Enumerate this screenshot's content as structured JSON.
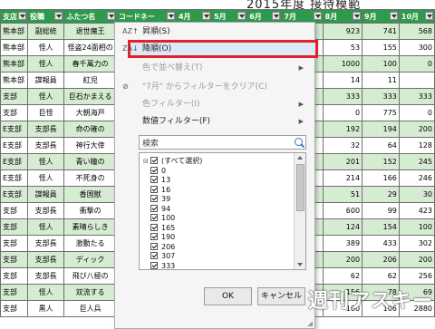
{
  "sheet": {
    "title_partial": "2015年度 接待模範",
    "headers": [
      "支店",
      "役職",
      "ふたつ名",
      "コードネー",
      "4月",
      "5月",
      "6月",
      "7月",
      "8月",
      "9月",
      "10月"
    ],
    "rows": [
      [
        "熊本部",
        "副総統",
        "退世魔王",
        "",
        "",
        "",
        "",
        "",
        "923",
        "741",
        "568"
      ],
      [
        "熊本部",
        "怪人",
        "怪盗24面相の",
        "",
        "",
        "",
        "",
        "",
        "53",
        "155",
        "300"
      ],
      [
        "熊本部",
        "怪人",
        "春千萬力の",
        "",
        "",
        "",
        "",
        "",
        "1000",
        "100",
        "0"
      ],
      [
        "熊本部",
        "諜報員",
        "紅児",
        "",
        "",
        "",
        "",
        "",
        "14",
        "11",
        ""
      ],
      [
        "支部",
        "怪人",
        "巨石かまえる",
        "",
        "",
        "",
        "",
        "",
        "333",
        "333",
        "333"
      ],
      [
        "支部",
        "巨怪",
        "大朝海戸",
        "",
        "",
        "",
        "",
        "",
        "0",
        "775",
        "0"
      ],
      [
        "E支部",
        "支部長",
        "命の確の",
        "",
        "",
        "",
        "",
        "",
        "192",
        "194",
        "200"
      ],
      [
        "E支部",
        "支部長",
        "神行大倖",
        "",
        "",
        "",
        "",
        "",
        "32",
        "64",
        "128"
      ],
      [
        "E支部",
        "怪人",
        "青い瞳の",
        "",
        "",
        "",
        "",
        "",
        "201",
        "152",
        "245"
      ],
      [
        "E支部",
        "怪人",
        "不死身の",
        "",
        "",
        "",
        "",
        "",
        "214",
        "166",
        "246"
      ],
      [
        "E支部",
        "諜報員",
        "香国獣",
        "",
        "",
        "",
        "",
        "",
        "51",
        "29",
        "30"
      ],
      [
        "支部",
        "支部長",
        "衝撃の",
        "",
        "",
        "",
        "",
        "",
        "600",
        "99",
        "423"
      ],
      [
        "支部",
        "怪人",
        "素晴らしき",
        "",
        "",
        "",
        "",
        "",
        "124",
        "154",
        "100"
      ],
      [
        "支部",
        "支部長",
        "激動たる",
        "",
        "",
        "",
        "",
        "",
        "389",
        "433",
        "302"
      ],
      [
        "支部",
        "支部長",
        "ディック",
        "",
        "",
        "",
        "",
        "",
        "200",
        "206",
        "200"
      ],
      [
        "支部",
        "支部長",
        "飛び八極の",
        "",
        "",
        "",
        "",
        "",
        "62",
        "62",
        "256"
      ],
      [
        "支部",
        "怪人",
        "双流する",
        "",
        "",
        "",
        "",
        "",
        "156",
        "78",
        "69"
      ],
      [
        "支部",
        "黒人",
        "巨人兵",
        "",
        "",
        "",
        "",
        "",
        "100",
        "106",
        "2880"
      ]
    ]
  },
  "menu": {
    "items": [
      {
        "icon": "AZ↑",
        "label": "昇順(S)",
        "disabled": false
      },
      {
        "icon": "ZA↓",
        "label": "降順(O)",
        "disabled": false
      },
      {
        "icon": "",
        "label": "色で並べ替え(T)",
        "disabled": true,
        "submenu": true
      },
      {
        "icon": "⊘",
        "label": "\"7月\" からフィルターをクリア(C)",
        "disabled": true
      },
      {
        "icon": "",
        "label": "色フィルター(I)",
        "disabled": true,
        "submenu": true
      },
      {
        "icon": "",
        "label": "数値フィルター(F)",
        "disabled": false,
        "submenu": true
      }
    ],
    "search_placeholder": "検索",
    "filter_values": [
      "(すべて選択)",
      "0",
      "13",
      "16",
      "39",
      "94",
      "100",
      "165",
      "190",
      "206",
      "307",
      "333"
    ],
    "ok_label": "OK",
    "cancel_label": "キャンセル"
  },
  "watermark": "週刊アスキー",
  "colors": {
    "header_green": "#2e9a4b",
    "row_green": "#d6ecd2",
    "highlight_border": "#e4202a"
  }
}
